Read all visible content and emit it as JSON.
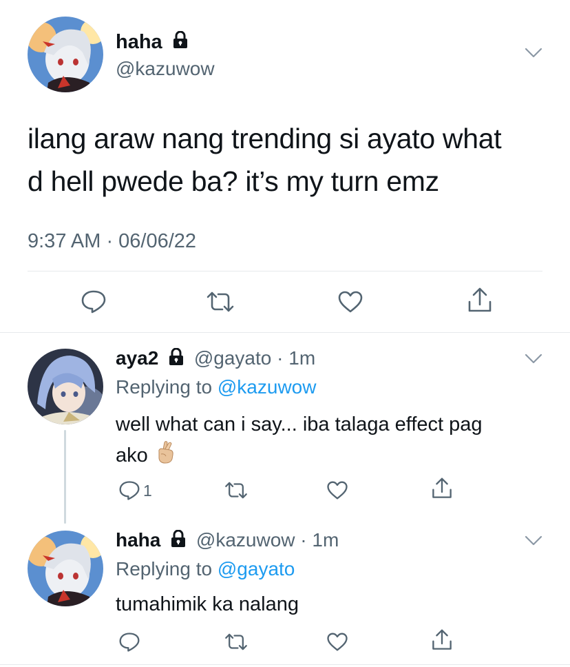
{
  "main_tweet": {
    "display_name": "haha",
    "handle": "@kazuwow",
    "text_line1": "ilang araw nang trending si ayato what",
    "text_line2": "d hell pwede ba? it’s my turn emz",
    "timestamp": "9:37 AM · 06/06/22"
  },
  "reply1": {
    "display_name": "aya2",
    "handle": "@gayato",
    "time": "· 1m",
    "replying_prefix": "Replying to ",
    "replying_to": "@kazuwow",
    "text_line1": "well what can i say... iba talaga effect pag",
    "text_line2": "ako",
    "reply_count": "1"
  },
  "reply2": {
    "display_name": "haha",
    "handle": "@kazuwow",
    "time": "· 1m",
    "replying_prefix": "Replying to ",
    "replying_to": "@gayato",
    "text": "tumahimik ka nalang"
  },
  "icons": {
    "reply": "speech-bubble-icon",
    "retweet": "retweet-arrows-icon",
    "like": "heart-outline-icon",
    "share": "share-upload-icon",
    "lock": "padlock-icon",
    "more": "chevron-down-icon",
    "emoji": "crossed-fingers-emoji"
  },
  "colors": {
    "link": "#1d9bf0",
    "muted": "#536471",
    "text": "#0f1419"
  }
}
